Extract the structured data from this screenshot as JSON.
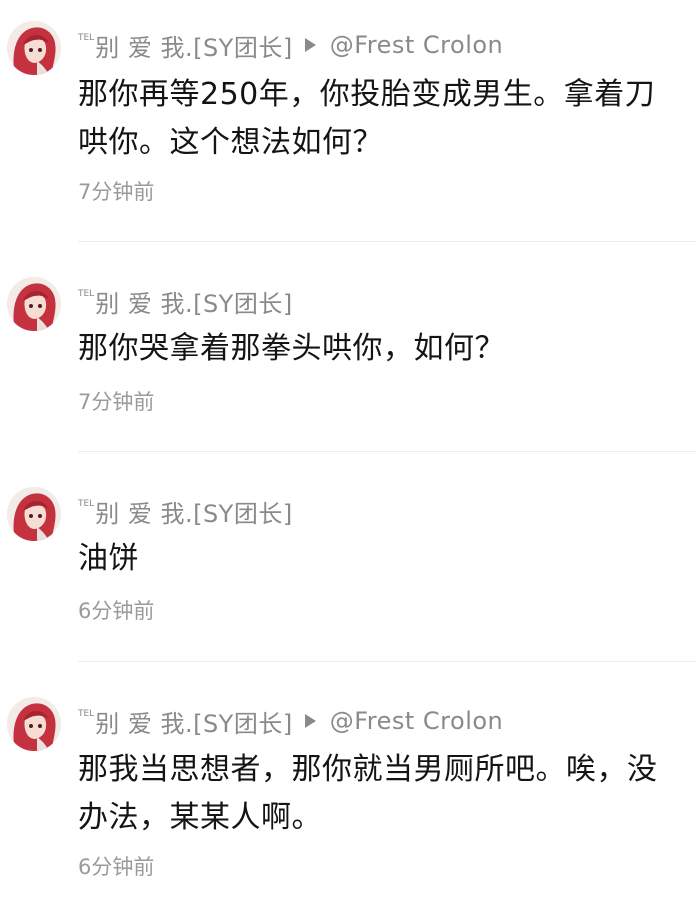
{
  "comments": [
    {
      "tel": "TEL",
      "username": "别 爱 我.[SY团长]",
      "reply_to": "@Frest  Crolon",
      "text": "那你再等250年，你投胎变成男生。拿着刀哄你。这个想法如何？",
      "time": "7分钟前"
    },
    {
      "tel": "TEL",
      "username": "别 爱 我.[SY团长]",
      "text": "那你哭拿着那拳头哄你，如何？",
      "time": "7分钟前"
    },
    {
      "tel": "TEL",
      "username": "别 爱 我.[SY团长]",
      "text": "油饼",
      "time": "6分钟前"
    },
    {
      "tel": "TEL",
      "username": "别 爱 我.[SY团长]",
      "reply_to": "@Frest  Crolon",
      "text": "那我当思想者，那你就当男厕所吧。唉，没办法，某某人啊。",
      "time": "6分钟前"
    }
  ],
  "colors": {
    "username": "#8a8a8a",
    "text": "#141414",
    "time": "#9a9a9a",
    "avatar_hair": "#c4323f"
  },
  "icons": {
    "reply": "play-triangle-icon"
  }
}
